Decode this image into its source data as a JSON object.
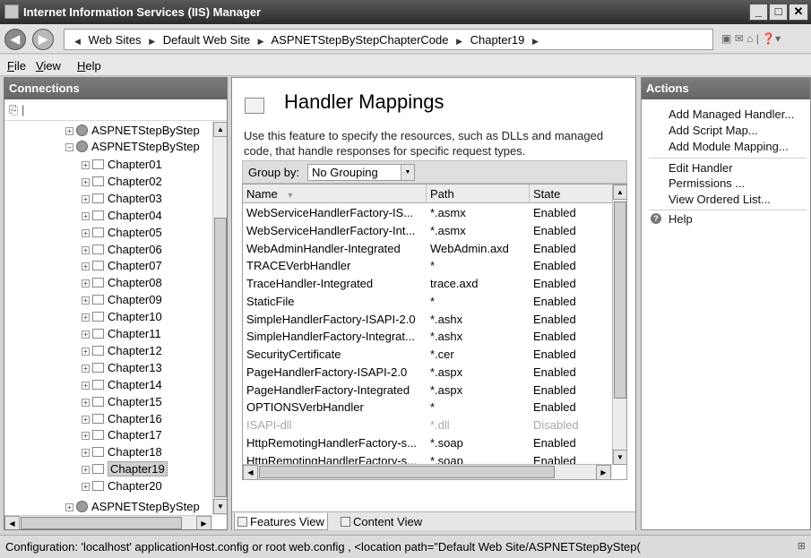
{
  "window": {
    "title": "Internet Information Services (IIS) Manager"
  },
  "address": {
    "crumbs": [
      "Web Sites",
      "Default Web Site",
      "ASPNETStepByStepChapterCode",
      "Chapter19"
    ]
  },
  "menu": {
    "file": "ile",
    "file_key": "F",
    "view": "iew",
    "view_key": "V",
    "help": "elp",
    "help_key": "H"
  },
  "connections": {
    "title": "Connections",
    "sites": [
      "ASPNETStepByStep",
      "ASPNETStepByStep",
      "ASPNETStepByStep"
    ],
    "chapters": [
      "Chapter01",
      "Chapter02",
      "Chapter03",
      "Chapter04",
      "Chapter05",
      "Chapter06",
      "Chapter07",
      "Chapter08",
      "Chapter09",
      "Chapter10",
      "Chapter11",
      "Chapter12",
      "Chapter13",
      "Chapter14",
      "Chapter15",
      "Chapter16",
      "Chapter17",
      "Chapter18",
      "Chapter19",
      "Chapter20"
    ],
    "selected": "Chapter19"
  },
  "feature": {
    "title": "Handler Mappings",
    "description": "Use this feature to specify the resources, such as DLLs and managed code, that handle responses for specific request types.",
    "group_by_label": "Group by:",
    "group_by_value": "No Grouping",
    "columns": {
      "name": "Name",
      "path": "Path",
      "state": "State"
    },
    "rows": [
      {
        "name": "WebServiceHandlerFactory-IS...",
        "path": "*.asmx",
        "state": "Enabled"
      },
      {
        "name": "WebServiceHandlerFactory-Int...",
        "path": "*.asmx",
        "state": "Enabled"
      },
      {
        "name": "WebAdminHandler-Integrated",
        "path": "WebAdmin.axd",
        "state": "Enabled"
      },
      {
        "name": "TRACEVerbHandler",
        "path": "*",
        "state": "Enabled"
      },
      {
        "name": "TraceHandler-Integrated",
        "path": "trace.axd",
        "state": "Enabled"
      },
      {
        "name": "StaticFile",
        "path": "*",
        "state": "Enabled"
      },
      {
        "name": "SimpleHandlerFactory-ISAPI-2.0",
        "path": "*.ashx",
        "state": "Enabled"
      },
      {
        "name": "SimpleHandlerFactory-Integrat...",
        "path": "*.ashx",
        "state": "Enabled"
      },
      {
        "name": "SecurityCertificate",
        "path": "*.cer",
        "state": "Enabled"
      },
      {
        "name": "PageHandlerFactory-ISAPI-2.0",
        "path": "*.aspx",
        "state": "Enabled"
      },
      {
        "name": "PageHandlerFactory-Integrated",
        "path": "*.aspx",
        "state": "Enabled"
      },
      {
        "name": "OPTIONSVerbHandler",
        "path": "*",
        "state": "Enabled"
      },
      {
        "name": "ISAPI-dll",
        "path": "*.dll",
        "state": "Disabled"
      },
      {
        "name": "HttpRemotingHandlerFactory-s...",
        "path": "*.soap",
        "state": "Enabled"
      },
      {
        "name": "HttpRemotingHandlerFactory-s...",
        "path": "*.soap",
        "state": "Enabled"
      }
    ],
    "tabs": {
      "features": "Features View",
      "content": "Content View"
    }
  },
  "actions": {
    "title": "Actions",
    "items": [
      "Add Managed Handler...",
      "Add Script Map...",
      "Add Module Mapping...",
      "Edit Handler",
      "Permissions ...",
      "View Ordered List...",
      "Help"
    ]
  },
  "status": {
    "text": "Configuration: 'localhost' applicationHost.config or root web.config , <location path=\"Default Web Site/ASPNETStepByStep("
  }
}
